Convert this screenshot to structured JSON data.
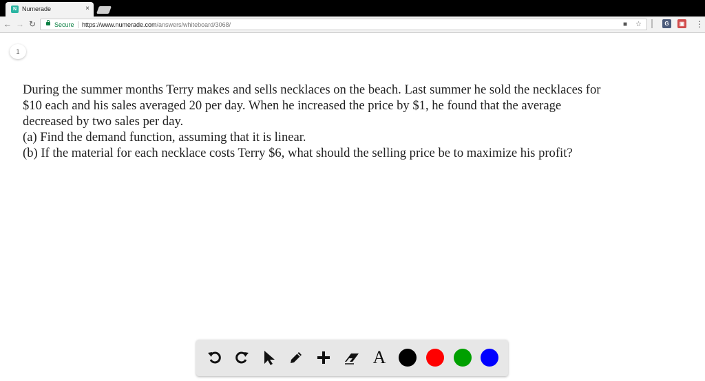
{
  "browser": {
    "tab_title": "Numerade",
    "tab_favicon": "N",
    "tab_close": "×",
    "secure_label": "Secure",
    "url_scheme_host": "https://www.numerade.com",
    "url_path": "/answers/whiteboard/3068/"
  },
  "page": {
    "page_number": "1",
    "question_lines": [
      "During the summer months Terry makes and sells necklaces on the beach. Last summer he sold the necklaces for",
      "$10 each and his sales averaged 20 per day. When he increased the price by $1, he found that the average",
      "decreased by two sales per day.",
      "(a) Find the demand function, assuming that it is linear.",
      "(b) If the material for each necklace costs Terry $6, what should the selling price be to maximize his profit?"
    ]
  },
  "whiteboard_toolbar": {
    "tools": [
      "undo-icon",
      "redo-icon",
      "select-arrow-icon",
      "pencil-icon",
      "plus-icon",
      "eraser-icon",
      "text-icon"
    ],
    "text_tool_label": "A",
    "colors": [
      "#000000",
      "#ff0000",
      "#00a000",
      "#0000ff"
    ]
  }
}
